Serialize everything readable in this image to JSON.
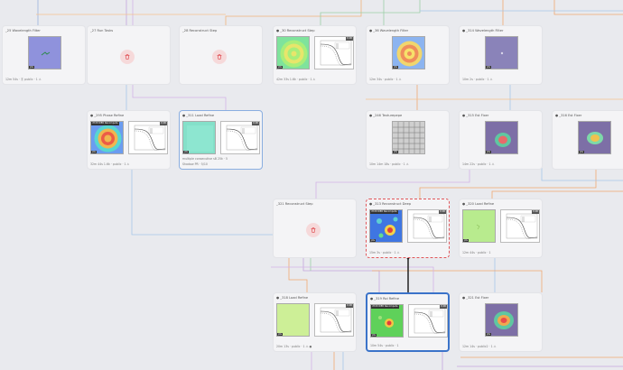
{
  "nodes": [
    {
      "id": "n1",
      "header": "_25   Wavelength Filter",
      "footer": "12m 54s  ·  Ⓢ  public  ·  1  ⚠",
      "kind": "image",
      "viz": "blue-plain"
    },
    {
      "id": "n2",
      "header": "_27   Run Tasks",
      "footer": "",
      "kind": "deleted"
    },
    {
      "id": "n3",
      "header": "_28   Reconstruct Step",
      "footer": "",
      "kind": "deleted"
    },
    {
      "id": "n4",
      "header": "● _30   Reconstruct Step",
      "footer": "42m 33s 1.6k  ·  public  ·  1  ⚠",
      "kind": "image+plot",
      "viz": "green-rings"
    },
    {
      "id": "n5",
      "header": "● _36   Wavelength Filter",
      "footer": "12m 34s  ·  public  ·  1  ⚠",
      "kind": "image",
      "viz": "blue-rings"
    },
    {
      "id": "n6",
      "header": "● _314   Wavelength Filter",
      "footer": "10m 2s  ·  public  ·  1  ⚠",
      "kind": "image",
      "viz": "purple-plain"
    },
    {
      "id": "n7",
      "header": "● _295   Phase Refine",
      "footer": "32m 44s 1.6k  ·  public  ·  1  ⚠",
      "kind": "image+plot",
      "viz": "rainbow-rings"
    },
    {
      "id": "n8",
      "header": "● _311   Load Refine",
      "footer": "Shadow PR  ·  5/10",
      "footer2": "multiple consecutive sB 25k  ·  5",
      "kind": "image+plot",
      "viz": "teal-plain"
    },
    {
      "id": "n9",
      "header": "● _246   Texturepepe",
      "footer": "10m 14m 18s  ·  public  ·  1  ⚠",
      "kind": "image",
      "viz": "gray-grid"
    },
    {
      "id": "n10",
      "header": "● _315   Est Fixer",
      "footer": "14m 22s  ·  public  ·  1  ⚠",
      "kind": "image",
      "viz": "purple-blob"
    },
    {
      "id": "n11",
      "header": "● _316   Est Fixer",
      "footer": "",
      "kind": "image",
      "viz": "purple-blob2"
    },
    {
      "id": "n12",
      "header": "_321   Reconstruct Step",
      "footer": "",
      "kind": "deleted"
    },
    {
      "id": "n13",
      "header": "● _313   Reconstruct Deep",
      "footer": "15m 3s  ·  public  ·  1  ⚠",
      "kind": "image+plot",
      "viz": "blue-noise"
    },
    {
      "id": "n14",
      "header": "● _320   Load Refine",
      "footer": "12m 44s  ·  public  ·  1",
      "kind": "image+plot",
      "viz": "lime-plain"
    },
    {
      "id": "n15",
      "header": "● _318   Load Refine",
      "footer": "20m 13s  ·  public  ·  1  ⚠  ●",
      "kind": "image+plot",
      "viz": "yellow-plain"
    },
    {
      "id": "n16",
      "header": "● _319   Roi Refine",
      "footer": "10m 54s  ·  public  ·  1",
      "kind": "image+plot",
      "viz": "green-noise"
    },
    {
      "id": "n17",
      "header": "● _321   Est Fixer",
      "footer": "12m 14s  ·  public2  ·  1  ⚠",
      "kind": "image",
      "viz": "purple-blob3"
    }
  ],
  "labels": {
    "thumb_tag": "dY20 6IE6 Recompute",
    "thumb_corner": "pts",
    "plot_badge": "0.00"
  },
  "colors": {
    "accent_blue": "#3b73c9",
    "danger": "#e0565a",
    "warning": "#e2a21b",
    "status_green": "#33b37a"
  }
}
